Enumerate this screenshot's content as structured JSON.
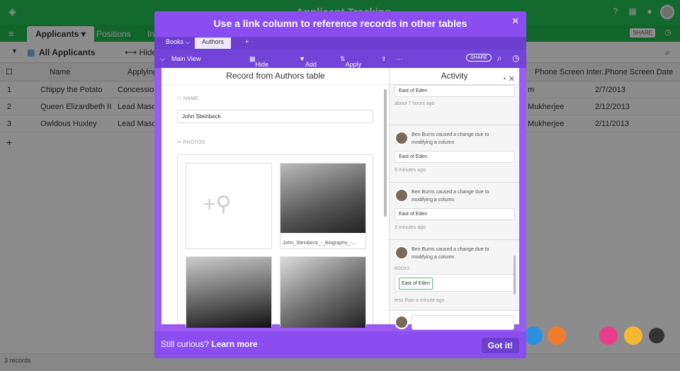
{
  "app": {
    "title": "Applicant Tracking"
  },
  "tabs": [
    {
      "label": "Applicants"
    },
    {
      "label": "Positions"
    },
    {
      "label": "In"
    }
  ],
  "share_label": "SHARE",
  "view": {
    "name": "All Applicants",
    "hide_label": "Hide"
  },
  "columns": [
    "Name",
    "Applying",
    "Phone Screen Inter...",
    "Phone Screen Date"
  ],
  "rows": [
    {
      "num": "1",
      "name": "Chippy the Potato",
      "applying": "Concession",
      "interviewer": "m",
      "date": "2/7/2013"
    },
    {
      "num": "2",
      "name": "Queen Elizardbeth II",
      "applying": "Lead Masco",
      "interviewer": "Mukherjee",
      "date": "2/12/2013"
    },
    {
      "num": "3",
      "name": "Owldous Huxley",
      "applying": "Lead Masco",
      "interviewer": "Mukherjee",
      "date": "2/11/2013"
    }
  ],
  "footer": {
    "records": "3 records"
  },
  "modal": {
    "title": "Use a link column to reference records in other tables",
    "tabs": [
      "Books",
      "Authors",
      "+"
    ],
    "toolbar": {
      "view": "Main View",
      "hide_columns": "Hide columns",
      "add_filter": "Add filter",
      "apply_sort": "Apply sort",
      "share": "SHARE"
    },
    "record": {
      "title": "Record from Authors table",
      "name_label": "NAME",
      "name_value": "John Steinbeck",
      "photos_label": "PHOTOS",
      "photo_caption": "John_Steinbeck_-_Biography_-..."
    },
    "activity": {
      "title": "Activity",
      "items": [
        {
          "chip": "East of Eden",
          "time": "about 7 hours ago"
        },
        {
          "text": "Ben Burns caused a change due to modifying a column",
          "chip": "East of Eden",
          "time": "9 minutes ago"
        },
        {
          "text": "Ben Burns caused a change due to modifying a column",
          "chip": "East of Eden",
          "time": "3 minutes ago"
        },
        {
          "text": "Ben Burns caused a change due to modifying a column",
          "books_label": "BOOKS",
          "chip": "East of Eden",
          "time": "less than a minute ago"
        }
      ]
    },
    "footer": {
      "text": "Still curious? ",
      "link": "Learn more",
      "button": "Got it!"
    }
  },
  "colors": {
    "brand_green": "#23c254",
    "modal_purple": "#8a4ef0",
    "accent_orange": "#f07c2b",
    "accent_pink": "#e83e8c",
    "accent_blue": "#2d8fe0",
    "accent_yellow": "#f5b82e"
  }
}
